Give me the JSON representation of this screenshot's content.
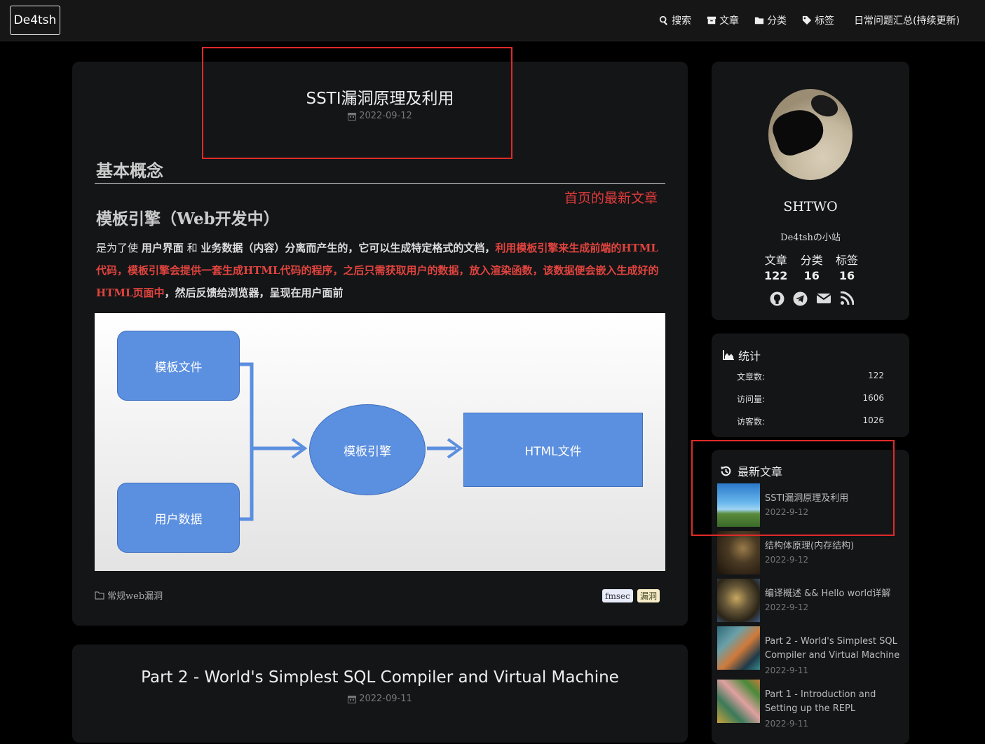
{
  "site": {
    "brand": "De4tsh"
  },
  "nav": [
    {
      "label": "搜索",
      "icon": "search-icon"
    },
    {
      "label": "文章",
      "icon": "archive-icon"
    },
    {
      "label": "分类",
      "icon": "folder-icon"
    },
    {
      "label": "标签",
      "icon": "tag-icon"
    },
    {
      "label": "日常问题汇总(持续更新)",
      "icon": ""
    }
  ],
  "post1": {
    "title": "SSTI漏洞原理及利用",
    "date": "2022-09-12",
    "annotation": "首页的最新文章",
    "h2": "基本概念",
    "h3": "模板引擎（Web开发中）",
    "para": {
      "p1": "是为了使 ",
      "b1": "用户界面",
      "p2": " 和 ",
      "b2": "业务数据（内容）",
      "p3": "分离而产生的，它可以生成特定格式的文档，",
      "red": "利用模板引擎来生成前端的HTML代码，模板引擎会提供一套生成HTML代码的程序，之后只需获取用户的数据，放入渲染函数，该数据便会嵌入生成好的HTML页面中",
      "p4": "，然后反馈给浏览器，呈现在用户面前"
    },
    "diagram": {
      "template_file": "模板文件",
      "user_data": "用户数据",
      "engine": "模板引擎",
      "html_file": "HTML文件"
    },
    "category": "常规web漏洞",
    "tags": [
      "fmsec",
      "漏洞"
    ]
  },
  "post2": {
    "title": "Part 2 - World's Simplest SQL Compiler and Virtual Machine",
    "date": "2022-09-11"
  },
  "profile": {
    "name": "SHTWO",
    "subtitle": "De4tshの小站",
    "counts": [
      {
        "label": "文章",
        "value": "122"
      },
      {
        "label": "分类",
        "value": "16"
      },
      {
        "label": "标签",
        "value": "16"
      }
    ],
    "social_icons": [
      "github-icon",
      "telegram-icon",
      "email-icon",
      "rss-icon"
    ]
  },
  "stats": {
    "title": "统计",
    "rows": [
      {
        "label": "文章数:",
        "value": "122"
      },
      {
        "label": "访问量:",
        "value": "1606"
      },
      {
        "label": "访客数:",
        "value": "1026"
      }
    ]
  },
  "recent": {
    "title": "最新文章",
    "items": [
      {
        "title": "SSTI漏洞原理及利用",
        "date": "2022-9-12",
        "thumb_colors": [
          "#3a8fd8",
          "#7fc3f0",
          "#4c7a2e"
        ]
      },
      {
        "title": "结构体原理(内存结构)",
        "date": "2022-9-12",
        "thumb_colors": [
          "#3a2a1c",
          "#8a6a3e",
          "#1c140c"
        ]
      },
      {
        "title": "编译概述 && Hello world详解",
        "date": "2022-9-12",
        "thumb_colors": [
          "#2a2418",
          "#b8984e",
          "#3c5a8a"
        ]
      },
      {
        "title": "Part 2 - World's Simplest SQL Compiler and Virtual Machine",
        "date": "2022-9-11",
        "thumb_colors": [
          "#2e6a7a",
          "#d07a3a",
          "#1e3a4a"
        ]
      },
      {
        "title": "Part 1 - Introduction and Setting up the REPL",
        "date": "2022-9-11",
        "thumb_colors": [
          "#c8a23a",
          "#3a7a5a",
          "#e0a0a0"
        ]
      }
    ]
  }
}
